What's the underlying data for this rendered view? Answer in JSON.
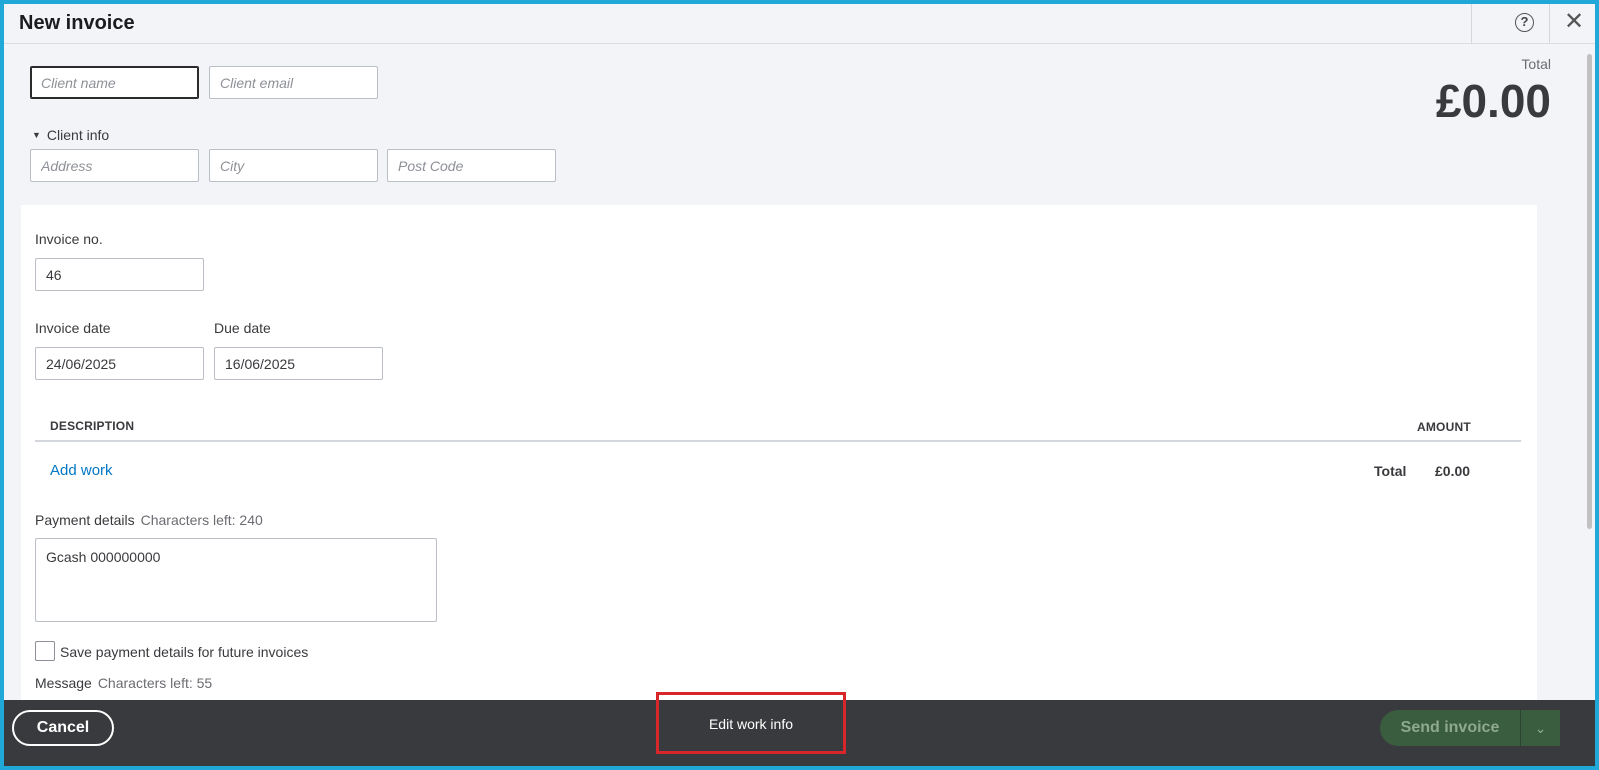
{
  "header": {
    "title": "New invoice",
    "help_glyph": "?",
    "close_glyph": "✕"
  },
  "client": {
    "name_placeholder": "Client name",
    "email_placeholder": "Client email",
    "info_toggle": "Client info",
    "address_placeholder": "Address",
    "city_placeholder": "City",
    "postcode_placeholder": "Post Code"
  },
  "summary": {
    "total_label": "Total",
    "total_amount": "£0.00"
  },
  "invoice": {
    "number_label": "Invoice no.",
    "number_value": "46",
    "date_label": "Invoice date",
    "date_value": "24/06/2025",
    "due_label": "Due date",
    "due_value": "16/06/2025"
  },
  "table": {
    "col_description": "DESCRIPTION",
    "col_amount": "AMOUNT",
    "add_work": "Add work",
    "total_label": "Total",
    "total_value": "£0.00"
  },
  "payment": {
    "label": "Payment details",
    "chars_left": "Characters left: 240",
    "value": "Gcash 000000000",
    "save_label": "Save payment details for future invoices",
    "save_checked": false
  },
  "message": {
    "label": "Message",
    "chars_left": "Characters left: 55"
  },
  "footer": {
    "cancel": "Cancel",
    "edit_work_info": "Edit work info",
    "send_invoice": "Send invoice",
    "send_caret": "⌄"
  },
  "colors": {
    "accent_border": "#1fa8d8",
    "link": "#0077c5",
    "highlight": "#d9262a",
    "send_bg": "#3a5d3f",
    "footer_bg": "#393a3d"
  }
}
